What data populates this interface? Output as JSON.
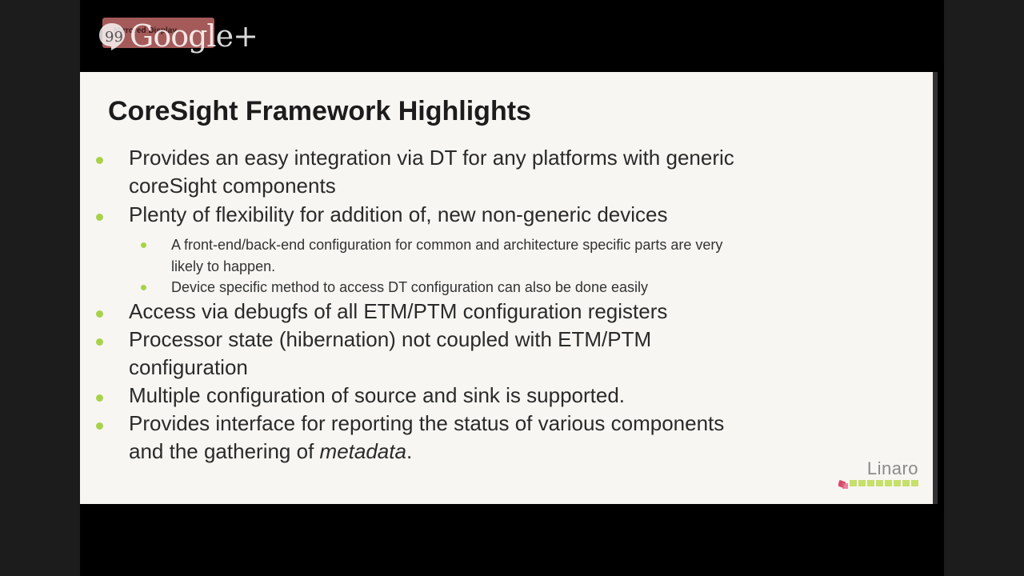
{
  "overlay": {
    "brand": "Google+",
    "badge_text": "Mirrored Display"
  },
  "slide": {
    "title": "CoreSight Framework Highlights",
    "bullets": [
      {
        "lines": [
          "Provides an easy integration via DT for any platforms with generic",
          "coreSight components"
        ]
      },
      {
        "lines": [
          "Plenty of flexibility for addition of, new non-generic devices"
        ]
      },
      {
        "lines": [
          "Access via debugfs of all ETM/PTM configuration registers"
        ]
      },
      {
        "lines": [
          "Processor state (hibernation) not coupled with ETM/PTM",
          "configuration"
        ]
      },
      {
        "lines": [
          "Multiple configuration of source and sink is supported."
        ]
      },
      {
        "lines": [
          "Provides interface for reporting the status of various components",
          "and the gathering of "
        ],
        "emphasis": "metadata",
        "tail": "."
      }
    ],
    "subbullets": [
      {
        "lines": [
          "A front-end/back-end configuration for common and architecture specific parts are very",
          "likely to happen."
        ]
      },
      {
        "lines": [
          "Device specific method to access DT configuration can also be done easily"
        ]
      }
    ],
    "logo_text": "Linaro"
  },
  "colors": {
    "bullet": "#a8d24a",
    "slide_bg": "#f7f6f2",
    "logo_bar": "#c6e06a",
    "logo_mark": "#d84a6a"
  },
  "icons": {
    "chat_bubble": "hangouts-bubble-icon",
    "logo_mark": "linaro-mark-icon"
  }
}
